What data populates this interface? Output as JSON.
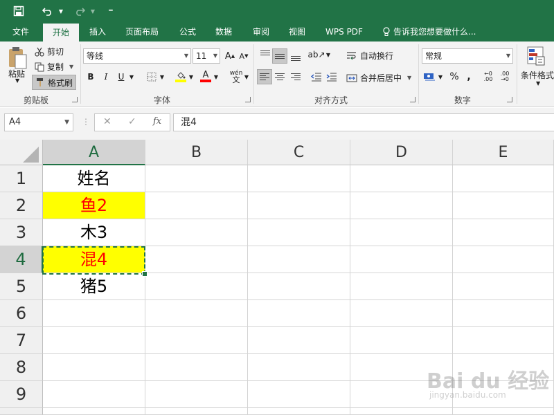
{
  "qat": {
    "save_icon": "save-icon",
    "undo_icon": "undo-icon",
    "redo_icon": "redo-icon",
    "customize_icon": "customize-qat-icon"
  },
  "tabs": {
    "items": [
      "文件",
      "开始",
      "插入",
      "页面布局",
      "公式",
      "数据",
      "审阅",
      "视图",
      "WPS PDF"
    ],
    "active": "开始",
    "tellme": "告诉我您想要做什么..."
  },
  "ribbon": {
    "clipboard": {
      "paste": "粘贴",
      "cut": "剪切",
      "copy": "复制",
      "format_painter": "格式刷",
      "label": "剪贴板"
    },
    "font": {
      "name": "等线",
      "size": "11",
      "bold": "B",
      "italic": "I",
      "underline": "U",
      "phonetic": "wén",
      "label": "字体",
      "fill_color": "#ffff00",
      "font_color": "#ff0000"
    },
    "alignment": {
      "wrap": "自动换行",
      "merge": "合并后居中",
      "label": "对齐方式"
    },
    "number": {
      "format": "常规",
      "percent": "%",
      "comma": ",",
      "label": "数字"
    },
    "styles": {
      "conditional": "条件格式"
    }
  },
  "formula_bar": {
    "name_box": "A4",
    "fx": "fx",
    "content": "混4"
  },
  "sheet": {
    "columns": [
      "A",
      "B",
      "C",
      "D",
      "E"
    ],
    "rows": [
      "1",
      "2",
      "3",
      "4",
      "5",
      "6",
      "7",
      "8",
      "9"
    ],
    "cells": {
      "A1": "姓名",
      "A2": "鱼2",
      "A3": "木3",
      "A4": "混4",
      "A5": "猪5"
    },
    "selected_cell": "A4",
    "highlight_fill": "#ffff00",
    "highlight_text": "#ff0000"
  },
  "watermark": {
    "logo": "Bai du 经验",
    "url": "jingyan.baidu.com"
  }
}
